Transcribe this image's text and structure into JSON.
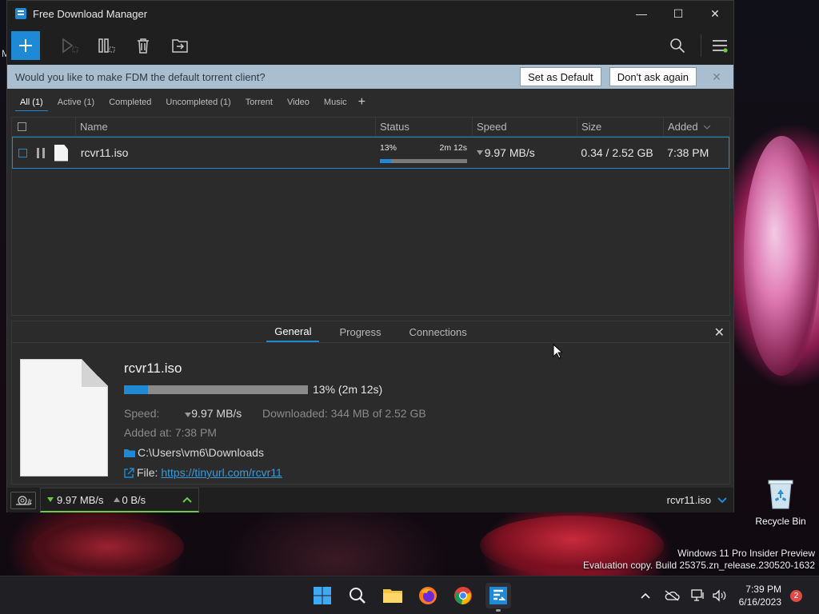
{
  "app": {
    "title": "Free Download Manager"
  },
  "window_controls": {
    "minimize": "—",
    "maximize": "☐",
    "close": "✕"
  },
  "notification": {
    "text": "Would you like to make FDM the default torrent client?",
    "set_default": "Set as Default",
    "dont_ask": "Don't ask again",
    "close": "✕"
  },
  "filters": {
    "items": [
      "All (1)",
      "Active (1)",
      "Completed",
      "Uncompleted (1)",
      "Torrent",
      "Video",
      "Music"
    ],
    "add": "+"
  },
  "list": {
    "columns": {
      "name": "Name",
      "status": "Status",
      "speed": "Speed",
      "size": "Size",
      "added": "Added"
    },
    "rows": [
      {
        "name": "rcvr11.iso",
        "status_percent": "13%",
        "status_time": "2m 12s",
        "progress": 0.13,
        "speed": "9.97 MB/s",
        "size": "0.34 / 2.52 GB",
        "added": "7:38 PM"
      }
    ]
  },
  "detail": {
    "tabs": [
      "General",
      "Progress",
      "Connections"
    ],
    "close": "✕",
    "file_name": "rcvr11.iso",
    "progress": 0.13,
    "progress_text": "13% (2m 12s)",
    "speed_label": "Speed:",
    "speed_value": "9.97 MB/s",
    "downloaded_label": "Downloaded:",
    "downloaded_value": "344 MB of 2.52 GB",
    "added_label": "Added at:",
    "added_value": "7:38 PM",
    "folder": "C:\\Users\\vm6\\Downloads",
    "file_label": "File:",
    "file_url": "https://tinyurl.com/rcvr11"
  },
  "statusbar": {
    "down_speed": "9.97 MB/s",
    "up_speed": "0 B/s",
    "current_file": "rcvr11.iso"
  },
  "desktop": {
    "recycle_bin": "Recycle Bin",
    "side_letter": "M",
    "watermark_line1": "Windows 11 Pro Insider Preview",
    "watermark_line2": "Evaluation copy. Build 25375.zn_release.230520-1632"
  },
  "taskbar": {
    "time": "7:39 PM",
    "date": "6/16/2023",
    "notifications": "2"
  },
  "colors": {
    "accent": "#1e8ad6",
    "speed_green": "#6acb44",
    "notify_bg": "#a9bfcf"
  }
}
